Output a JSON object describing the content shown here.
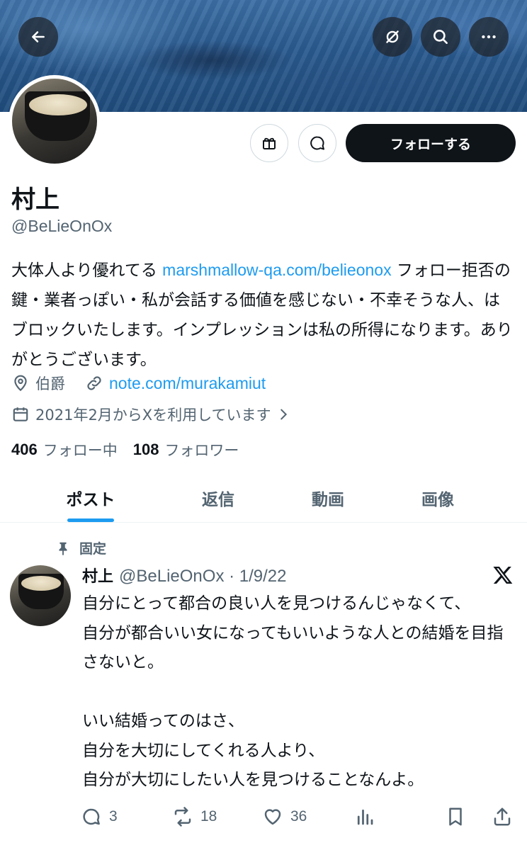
{
  "profile": {
    "name": "村上",
    "handle": "@BeLieOnOx",
    "bio_text": "大体人より優れてる ",
    "bio_link": "marshmallow-qa.com/belieonox",
    "bio_rest": " フォロー拒否の鍵・業者っぽい・私が会話する価値を感じない・不幸そうな人、はブロックいたします。インプレッションは私の所得になります。ありがとうございます。",
    "location": "伯爵",
    "website": "note.com/murakamiut",
    "joined": "2021年2月からXを利用しています",
    "following_count": "406",
    "following_label": "フォロー中",
    "followers_count": "108",
    "followers_label": "フォロワー"
  },
  "header": {
    "back_icon": "arrow-left-icon",
    "grok_icon": "grok-icon",
    "search_icon": "search-icon",
    "more_icon": "more-icon"
  },
  "actions_bar": {
    "follow_label": "フォローする",
    "gift_icon": "gift-icon",
    "message_icon": "message-icon"
  },
  "tabs": [
    {
      "label": "ポスト",
      "active": true
    },
    {
      "label": "返信",
      "active": false
    },
    {
      "label": "動画",
      "active": false
    },
    {
      "label": "画像",
      "active": false
    }
  ],
  "pinned_post": {
    "pinned_label": "固定",
    "author_name": "村上",
    "author_handle_date": "@BeLieOnOx · 1/9/22",
    "body": "自分にとって都合の良い人を見つけるんじゃなくて、\n自分が都合いい女になってもいいような人との結婚を目指さないと。\n\nいい結婚ってのはさ、\n自分を大切にしてくれる人より、\n自分が大切にしたい人を見つけることなんよ。",
    "replies": "3",
    "reposts": "18",
    "likes": "36"
  },
  "colors": {
    "accent": "#1d9bf0",
    "text": "#0f1419",
    "secondary": "#536471"
  }
}
